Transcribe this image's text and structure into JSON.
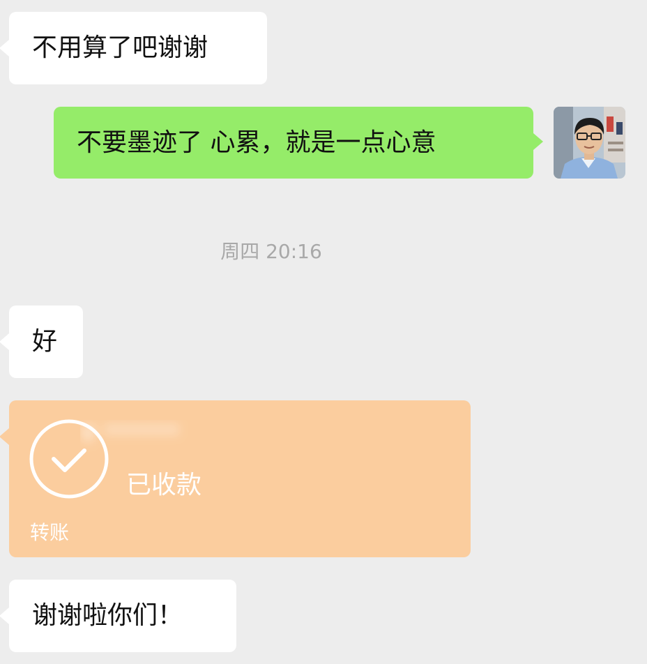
{
  "messages": {
    "m1": "不用算了吧谢谢",
    "m2": "不要墨迹了 心累，就是一点心意",
    "timestamp": "周四 20:16",
    "m3": "好",
    "m5": "谢谢啦你们！"
  },
  "transfer": {
    "amount": "¥ ******",
    "status": "已收款",
    "label": "转账"
  },
  "colors": {
    "background": "#ededed",
    "incoming_bubble": "#ffffff",
    "outgoing_bubble": "#95ec69",
    "transfer_card": "#fbcd9e",
    "timestamp_text": "#a8a8a8"
  },
  "icons": {
    "avatar": "user-avatar-photo",
    "transfer_check": "check-circle-icon"
  }
}
